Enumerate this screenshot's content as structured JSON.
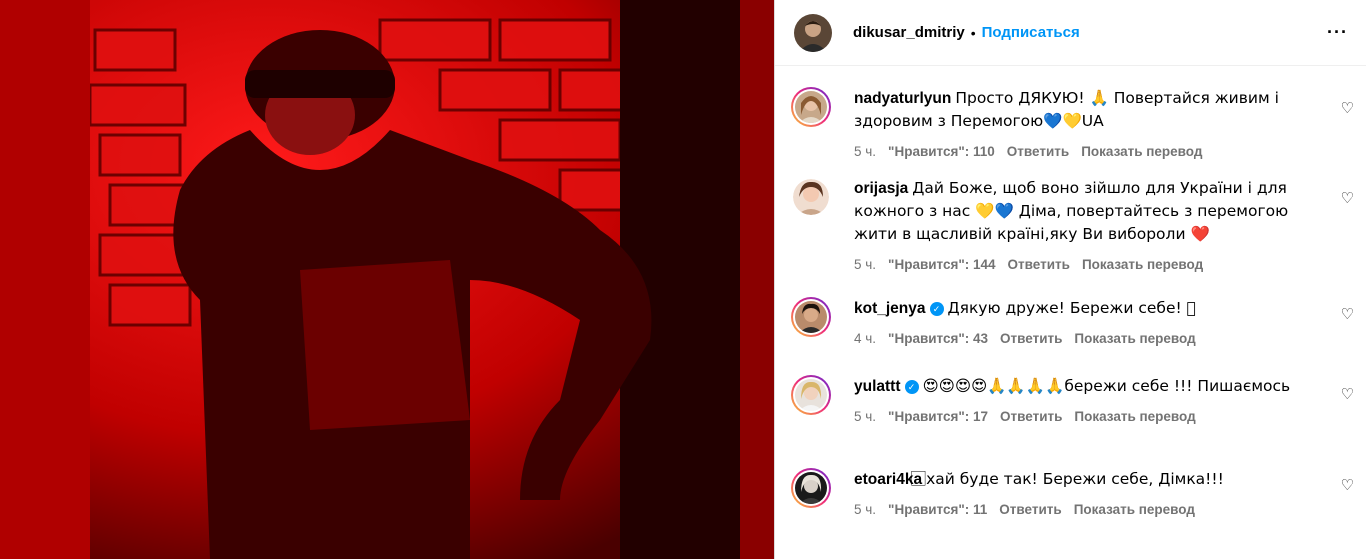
{
  "header": {
    "username": "dikusar_dmitriy",
    "separator": "•",
    "follow_label": "Подписаться",
    "more_label": "···"
  },
  "comments": [
    {
      "user": "nadyaturlyun",
      "verified": false,
      "text": "Просто ДЯКУЮ! 🙏 Повертайся живим і здоровим з Перемогою💙💛UA",
      "time": "5 ч.",
      "likes": "\"Нравится\": 110",
      "reply": "Ответить",
      "translate": "Показать перевод"
    },
    {
      "user": "orijasja",
      "verified": false,
      "text": "Дай Боже, щоб воно зійшло для України і для кожного з нас 💛💙 Діма, повертайтесь з перемогою жити в щасливій країні,яку Ви вибороли ❤️",
      "time": "5 ч.",
      "likes": "\"Нравится\": 144",
      "reply": "Ответить",
      "translate": "Показать перевод"
    },
    {
      "user": "kot_jenya",
      "verified": true,
      "text": "Дякую друже! Бережи себе! ⃞",
      "time": "4 ч.",
      "likes": "\"Нравится\": 43",
      "reply": "Ответить",
      "translate": "Показать перевод"
    },
    {
      "user": "yulattt",
      "verified": true,
      "text": "😍😍😍😍🙏🙏🙏🙏бережи себе !!! Пишаємось",
      "time": "5 ч.",
      "likes": "\"Нравится\": 17",
      "reply": "Ответить",
      "translate": "Показать перевод"
    },
    {
      "user": "etoari4ka",
      "verified": false,
      "text": "⃞хай буде так! Бережи себе, Дімка!!!",
      "time": "5 ч.",
      "likes": "\"Нравится\": 11",
      "reply": "Ответить",
      "translate": "Показать перевод"
    }
  ],
  "icons": {
    "heart": "♡"
  },
  "colors": {
    "accent": "#0095f6",
    "photo_tint": "#c40000"
  }
}
